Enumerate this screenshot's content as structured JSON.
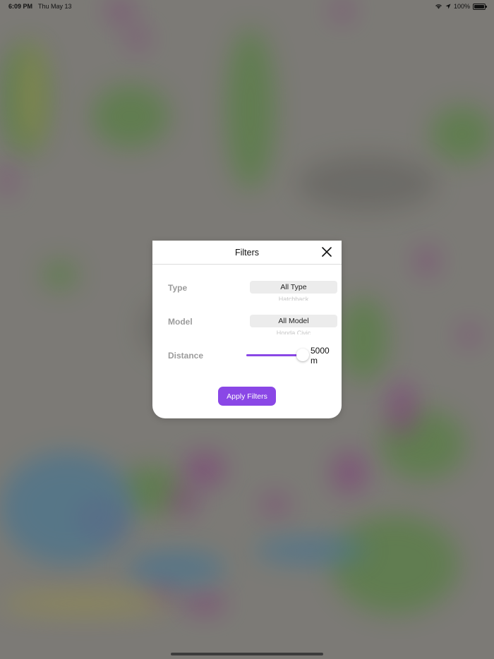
{
  "status_bar": {
    "time": "6:09 PM",
    "date": "Thu May 13",
    "battery": "100%",
    "icons": [
      "wifi-icon",
      "location-arrow-icon",
      "battery-icon"
    ]
  },
  "modal": {
    "title": "Filters",
    "type": {
      "label": "Type",
      "selected": "All Type",
      "next_option": "Hatchback"
    },
    "model": {
      "label": "Model",
      "selected": "All Model",
      "next_option": "Honda Civic"
    },
    "distance": {
      "label": "Distance",
      "value_text": "5000 m",
      "slider_fraction": 1.0
    },
    "apply_label": "Apply Filters"
  },
  "colors": {
    "accent": "#8a47e6",
    "label_gray": "#9b9b9b",
    "picker_bg": "#ececec"
  }
}
